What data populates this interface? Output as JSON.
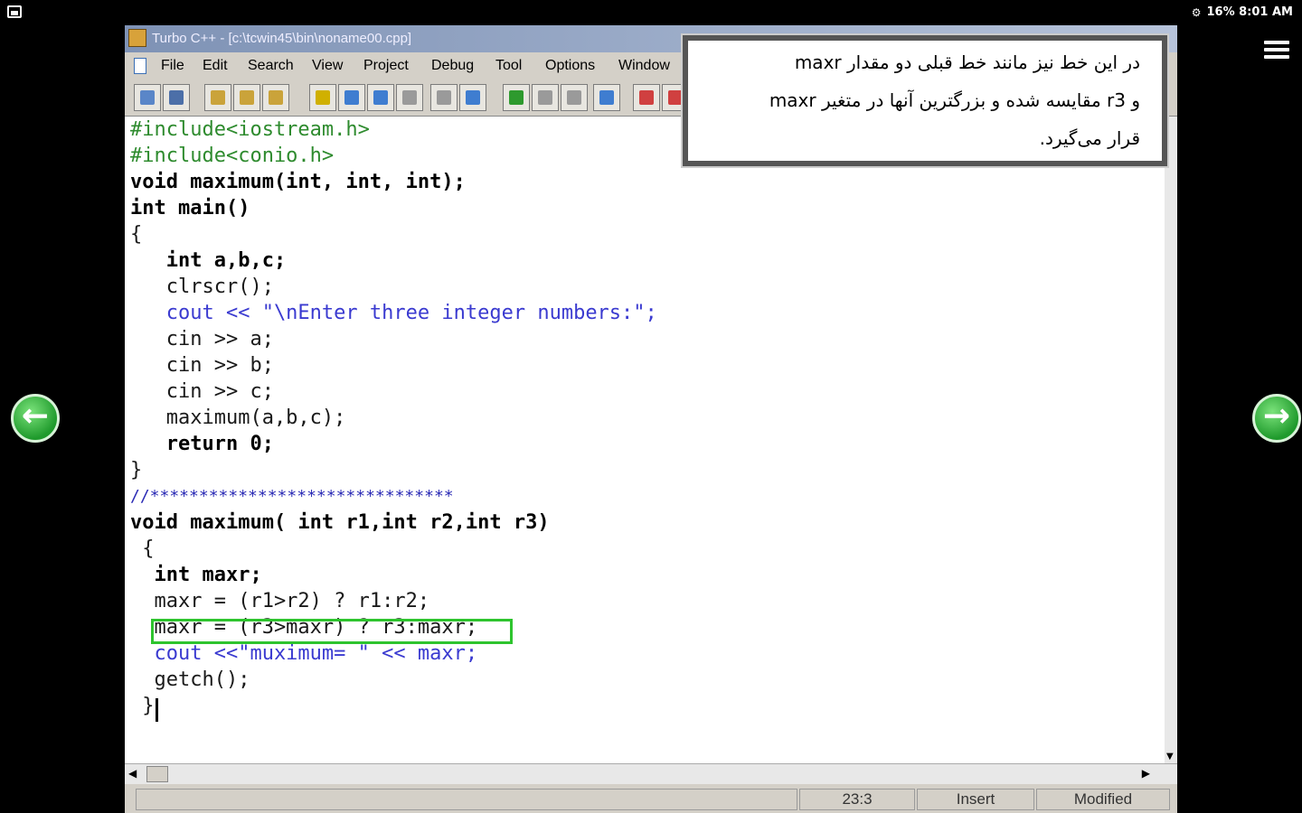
{
  "status_bar": {
    "right_text": "16% 8:01 AM",
    "icons": [
      "gear-icon",
      "wifi-icon",
      "signal-icon",
      "battery-icon"
    ]
  },
  "window": {
    "title": "Turbo C++ - [c:\\tcwin45\\bin\\noname00.cpp]",
    "menu": [
      "File",
      "Edit",
      "Search",
      "View",
      "Project",
      "Debug",
      "Tool",
      "Options",
      "Window"
    ],
    "toolbar_icons": [
      "open-file-icon",
      "save-file-icon",
      "copy-icon",
      "cut-icon",
      "paste-icon",
      "compile-icon",
      "make-icon",
      "build-icon",
      "run-icon",
      "step-icon",
      "trace-icon",
      "undo-icon",
      "breakpoint-icon",
      "help-icon",
      "tool-icon",
      "debug-icon"
    ]
  },
  "code": {
    "lines": [
      "#include<iostream.h>",
      "#include<conio.h>",
      "void maximum(int, int, int);",
      "int main()",
      "{",
      "   int a,b,c;",
      "   clrscr();",
      "   cout << \"\\nEnter three integer numbers:\";",
      "   cin >> a;",
      "   cin >> b;",
      "   cin >> c;",
      "   maximum(a,b,c);",
      "   return 0;",
      "}",
      "//*******************************",
      "void maximum( int r1,int r2,int r3)",
      " {",
      "  int maxr;",
      "  maxr = (r1>r2) ? r1:r2;",
      "  maxr = (r3>maxr) ? r3:maxr;",
      "  cout <<\"muximum= \" << maxr;",
      "  getch();",
      " }"
    ]
  },
  "status": {
    "position": "23:3",
    "mode": "Insert",
    "state": "Modified"
  },
  "annotation": {
    "lines": [
      "در این خط نیز مانند خط قبلی دو مقدار maxr",
      "و r3 مقایسه شده و بزرگترین آنها در متغیر maxr",
      "قرار می‌گیرد."
    ]
  },
  "colors": {
    "highlight": "#2ec42e",
    "preprocessor": "#2e8b2e",
    "string": "#3a3ad0",
    "nav_arrow": "#1f9a2c"
  }
}
